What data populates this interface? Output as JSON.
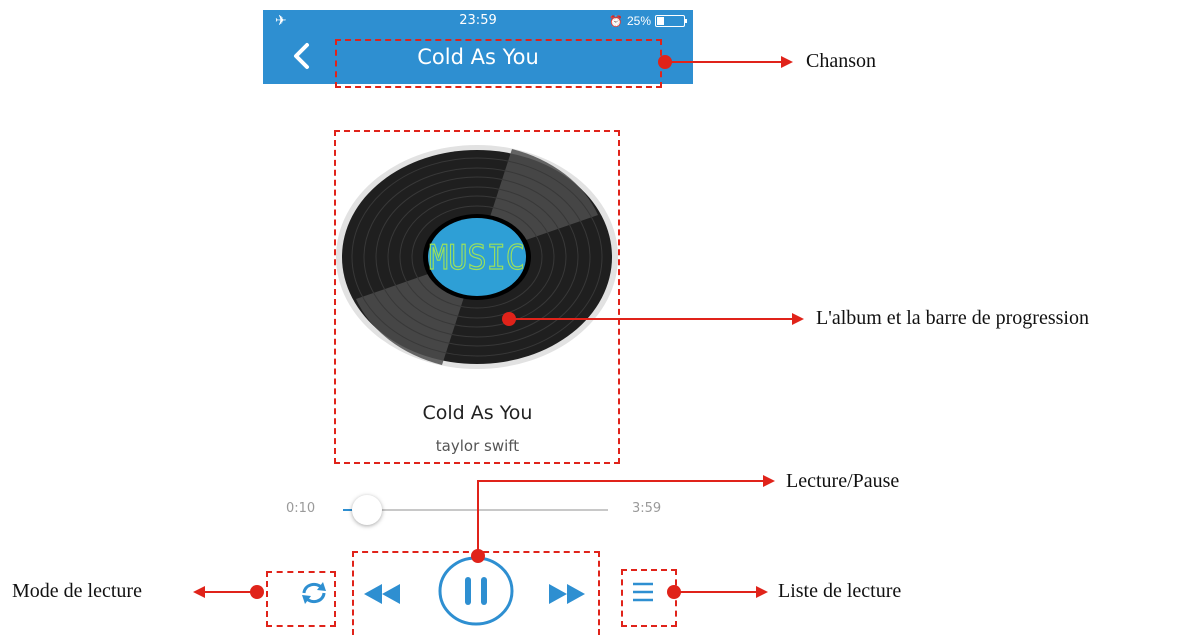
{
  "status": {
    "time": "23:59",
    "battery": "25%",
    "battery_level": 0.25
  },
  "nav": {
    "title": "Cold As You"
  },
  "album": {
    "disc_label": "MUSIC",
    "song_title": "Cold As You",
    "artist": "taylor swift"
  },
  "progress": {
    "current": "0:10",
    "total": "3:59",
    "fraction": 0.042
  },
  "annotations": {
    "song": "Chanson",
    "album": "L'album et la barre de progression",
    "play_pause": "Lecture/Pause",
    "play_mode": "Mode de lecture",
    "playlist": "Liste de lecture"
  },
  "colors": {
    "accent": "#2e8fd1",
    "annotation": "#e0231a"
  },
  "icons": [
    "airplane-icon",
    "alarm-icon",
    "battery-icon",
    "back-icon",
    "vinyl-disc",
    "repeat-icon",
    "rewind-icon",
    "pause-icon",
    "fast-forward-icon",
    "playlist-icon"
  ]
}
